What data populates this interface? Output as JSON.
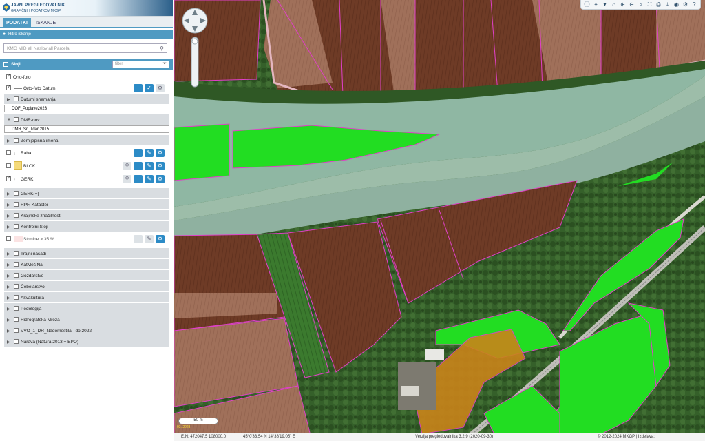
{
  "header": {
    "title": "JAVNI PREGLEDOVALNIK",
    "subtitle": "GRAFIČNIH PODATKOV MKGP"
  },
  "tabs": [
    {
      "label": "PODATKI"
    },
    {
      "label": "ISKANJE"
    }
  ],
  "quick_search": {
    "label": "Hitro iskanje",
    "placeholder": "KMG MID all Naslov all Parcela"
  },
  "layers_panel": {
    "title": "Sloji",
    "filter_placeholder": "filter"
  },
  "layers": {
    "orto": {
      "label": "Orto-foto",
      "child": "Orto-foto Datum"
    },
    "datumi": {
      "label": "Datumi snemanja",
      "child": "DOF_Poplave2023"
    },
    "dmr": {
      "label": "DMR-nov",
      "child": "DMR_Sn_lidar 2015"
    },
    "zemljepisna": {
      "label": "Zemljepisna imena"
    },
    "raba": {
      "label": "Raba"
    },
    "block": {
      "label": "BLOK"
    },
    "gerk": {
      "label": "GERK"
    },
    "gerkplus": {
      "label": "GERK(+)"
    },
    "rpf": {
      "label": "RPF, Kataster"
    },
    "krajinske": {
      "label": "Krajinske značilnosti"
    },
    "kontrolni": {
      "label": "Kontrolni Sloji"
    },
    "strmine": {
      "label": "Strmine > 35 %"
    },
    "trajni": {
      "label": "Trajni nasadi"
    },
    "katmesina": {
      "label": "KatMešiNa"
    },
    "gozdarstvo": {
      "label": "Gozdarstvo"
    },
    "cebelarstvo": {
      "label": "Čebelarstvo"
    },
    "akvakultura": {
      "label": "Akvakultura"
    },
    "pedologija": {
      "label": "Pedologija"
    },
    "hidro": {
      "label": "Hidrografska Mreža"
    },
    "vvo": {
      "label": "VVO_1_DR_Nadomestila - do 2022"
    },
    "narava": {
      "label": "Narava (Natura 2013 + EPO)"
    }
  },
  "map": {
    "scale": "50 m",
    "coords_gk": "E,N: 472047,5 108000,0",
    "coords_wgs": "45°0'33,54 N 14°38'19,05\" E",
    "version": "Verzija pregledovalnika 3.2.9 (2020-09-30)",
    "copyright": "© 2012-2024 MKGP | Izdelava:",
    "date_label": "03. 2023"
  },
  "colors": {
    "gerk_green": "#22dd22",
    "block_yellow": "#f5da7a",
    "parcel_line": "#e040c8",
    "accent": "#4f9ac2"
  },
  "icons": [
    "info-icon",
    "pin-icon",
    "home-icon",
    "zoom-in-icon",
    "zoom-out-icon",
    "measure-icon",
    "print-icon",
    "globe-icon",
    "help-icon"
  ]
}
